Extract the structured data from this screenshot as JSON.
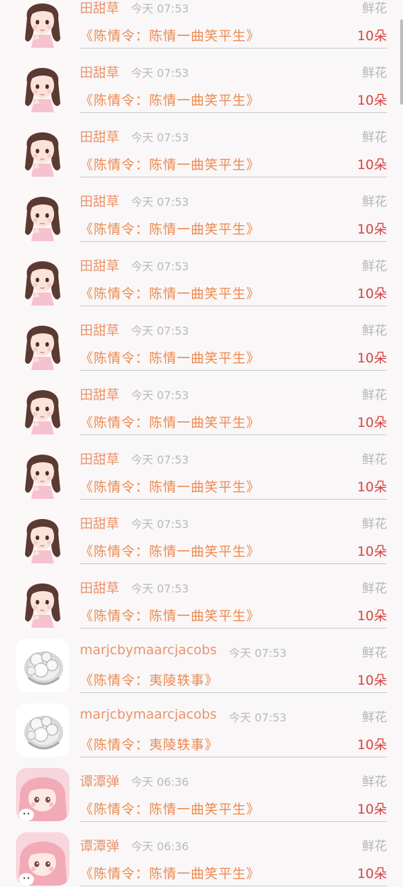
{
  "gift_list": [
    {
      "user": "田甜草",
      "time": "今天 07:53",
      "gift": "鲜花",
      "work": "《陈情令：陈情一曲笑平生》",
      "count": "10朵",
      "avatar": "girl-dark-hair-avatar"
    },
    {
      "user": "田甜草",
      "time": "今天 07:53",
      "gift": "鲜花",
      "work": "《陈情令：陈情一曲笑平生》",
      "count": "10朵",
      "avatar": "girl-dark-hair-avatar"
    },
    {
      "user": "田甜草",
      "time": "今天 07:53",
      "gift": "鲜花",
      "work": "《陈情令：陈情一曲笑平生》",
      "count": "10朵",
      "avatar": "girl-dark-hair-avatar"
    },
    {
      "user": "田甜草",
      "time": "今天 07:53",
      "gift": "鲜花",
      "work": "《陈情令：陈情一曲笑平生》",
      "count": "10朵",
      "avatar": "girl-dark-hair-avatar"
    },
    {
      "user": "田甜草",
      "time": "今天 07:53",
      "gift": "鲜花",
      "work": "《陈情令：陈情一曲笑平生》",
      "count": "10朵",
      "avatar": "girl-dark-hair-avatar"
    },
    {
      "user": "田甜草",
      "time": "今天 07:53",
      "gift": "鲜花",
      "work": "《陈情令：陈情一曲笑平生》",
      "count": "10朵",
      "avatar": "girl-dark-hair-avatar"
    },
    {
      "user": "田甜草",
      "time": "今天 07:53",
      "gift": "鲜花",
      "work": "《陈情令：陈情一曲笑平生》",
      "count": "10朵",
      "avatar": "girl-dark-hair-avatar"
    },
    {
      "user": "田甜草",
      "time": "今天 07:53",
      "gift": "鲜花",
      "work": "《陈情令：陈情一曲笑平生》",
      "count": "10朵",
      "avatar": "girl-dark-hair-avatar"
    },
    {
      "user": "田甜草",
      "time": "今天 07:53",
      "gift": "鲜花",
      "work": "《陈情令：陈情一曲笑平生》",
      "count": "10朵",
      "avatar": "girl-dark-hair-avatar"
    },
    {
      "user": "田甜草",
      "time": "今天 07:53",
      "gift": "鲜花",
      "work": "《陈情令：陈情一曲笑平生》",
      "count": "10朵",
      "avatar": "girl-dark-hair-avatar"
    },
    {
      "user": "marjcbymaarcjacobs",
      "time": "今天 07:53",
      "gift": "鲜花",
      "work": "《陈情令：夷陵轶事》",
      "count": "10朵",
      "avatar": "silver-ring-avatar"
    },
    {
      "user": "marjcbymaarcjacobs",
      "time": "今天 07:53",
      "gift": "鲜花",
      "work": "《陈情令：夷陵轶事》",
      "count": "10朵",
      "avatar": "silver-ring-avatar"
    },
    {
      "user": "谭潭弹",
      "time": "今天 06:36",
      "gift": "鲜花",
      "work": "《陈情令：陈情一曲笑平生》",
      "count": "10朵",
      "avatar": "pink-girl-avatar"
    },
    {
      "user": "谭潭弹",
      "time": "今天 06:36",
      "gift": "鲜花",
      "work": "《陈情令：陈情一曲笑平生》",
      "count": "10朵",
      "avatar": "pink-girl-avatar"
    }
  ]
}
